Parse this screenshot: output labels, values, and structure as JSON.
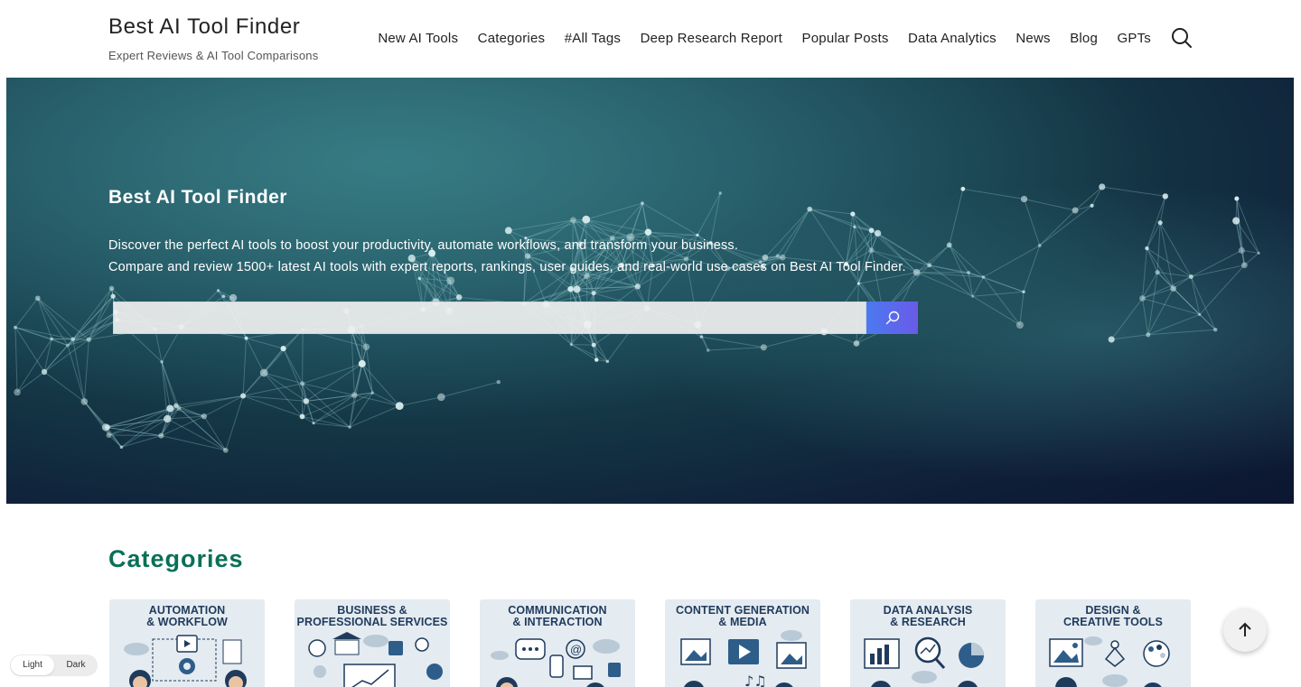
{
  "header": {
    "site_title": "Best AI Tool Finder",
    "tagline": "Expert Reviews & AI Tool Comparisons",
    "nav": [
      {
        "label": "New AI Tools"
      },
      {
        "label": "Categories"
      },
      {
        "label": "#All Tags"
      },
      {
        "label": "Deep Research Report"
      },
      {
        "label": "Popular Posts"
      },
      {
        "label": "Data Analytics"
      },
      {
        "label": "News"
      },
      {
        "label": "Blog"
      },
      {
        "label": "GPTs"
      }
    ],
    "search_icon": "search-icon"
  },
  "hero": {
    "title": "Best AI Tool Finder",
    "desc_line1": "Discover the perfect AI tools to boost your productivity, automate workflows, and transform your business.",
    "desc_line2": "Compare and review 1500+ latest AI tools with expert reports, rankings, user guides, and real-world use cases on Best AI Tool Finder.",
    "search_placeholder": "",
    "search_button_icon": "search-icon",
    "background": "network-nodes-image"
  },
  "categories": {
    "heading": "Categories",
    "heading_color": "#0a7058",
    "items": [
      {
        "line1": "AUTOMATION",
        "line2": "& WORKFLOW"
      },
      {
        "line1": "BUSINESS &",
        "line2": "PROFESSIONAL SERVICES"
      },
      {
        "line1": "COMMUNICATION",
        "line2": "& INTERACTION"
      },
      {
        "line1": "CONTENT GENERATION",
        "line2": "& MEDIA"
      },
      {
        "line1": "DATA ANALYSIS",
        "line2": "& RESEARCH"
      },
      {
        "line1": "DESIGN &",
        "line2": "CREATIVE TOOLS"
      }
    ]
  },
  "theme_toggle": {
    "light": "Light",
    "dark": "Dark",
    "selected": "Light"
  },
  "back_to_top_icon": "arrow-up-icon"
}
